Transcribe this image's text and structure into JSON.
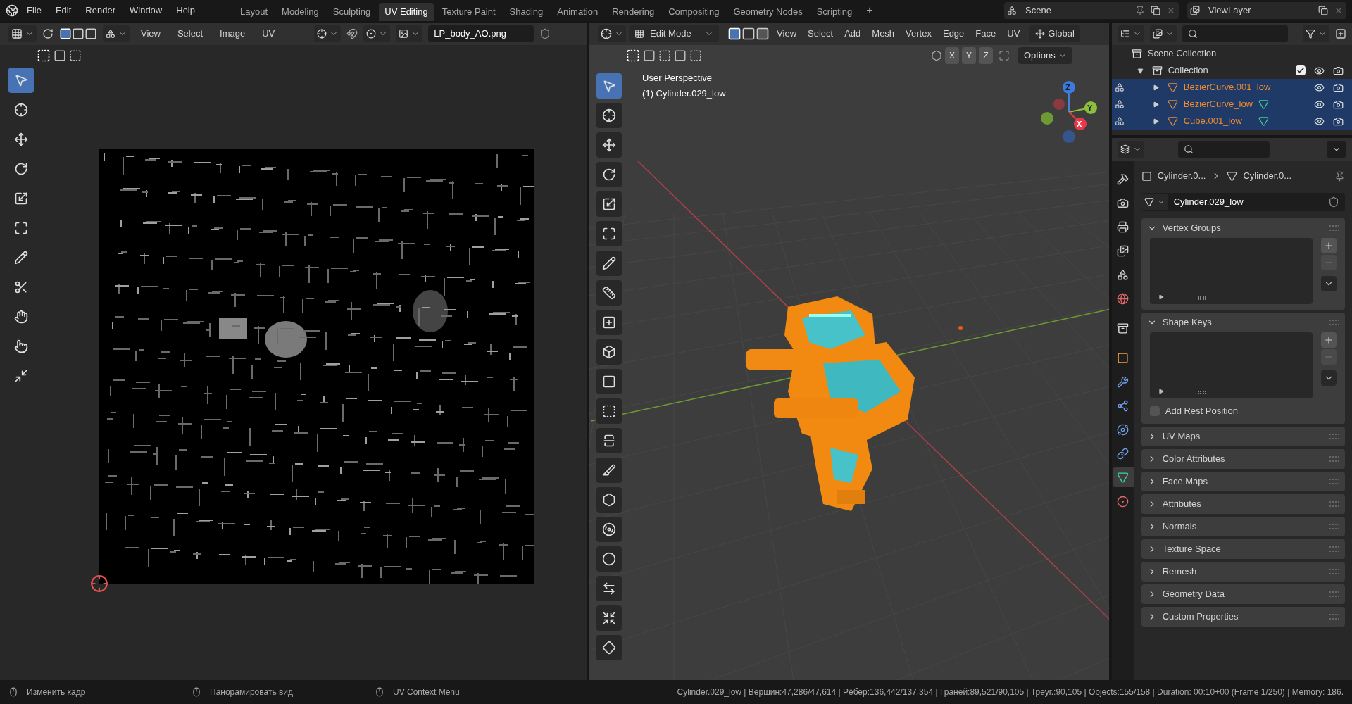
{
  "menu": [
    "File",
    "Edit",
    "Render",
    "Window",
    "Help"
  ],
  "workspaces": [
    {
      "label": "Layout",
      "selected": false
    },
    {
      "label": "Modeling",
      "selected": false
    },
    {
      "label": "Sculpting",
      "selected": false
    },
    {
      "label": "UV Editing",
      "selected": true
    },
    {
      "label": "Texture Paint",
      "selected": false
    },
    {
      "label": "Shading",
      "selected": false
    },
    {
      "label": "Animation",
      "selected": false
    },
    {
      "label": "Rendering",
      "selected": false
    },
    {
      "label": "Compositing",
      "selected": false
    },
    {
      "label": "Geometry Nodes",
      "selected": false
    },
    {
      "label": "Scripting",
      "selected": false
    }
  ],
  "add_workspace": "+",
  "scene": "Scene",
  "view_layer": "ViewLayer",
  "uv_editor": {
    "menus": [
      "View",
      "Select",
      "Image",
      "UV"
    ],
    "image": "LP_body_AO.png",
    "tools": [
      {
        "kind": "select",
        "selected": true
      },
      {
        "kind": "cursor",
        "selected": false
      },
      {
        "kind": "move",
        "selected": false
      },
      {
        "kind": "rotate",
        "selected": false
      },
      {
        "kind": "scale",
        "selected": false
      },
      {
        "kind": "transform",
        "selected": false
      },
      {
        "kind": "annotate",
        "selected": false
      },
      {
        "kind": "rip",
        "selected": false
      },
      {
        "kind": "grab",
        "selected": false
      },
      {
        "kind": "relax",
        "selected": false
      },
      {
        "kind": "pinch",
        "selected": false
      }
    ],
    "texture": {
      "kind": "picture"
    }
  },
  "viewport": {
    "mode": "Edit Mode",
    "menus": [
      "View",
      "Select",
      "Add",
      "Mesh",
      "Vertex",
      "Edge",
      "Face",
      "UV"
    ],
    "orientation": "Global",
    "mirror_axes": [
      "X",
      "Y",
      "Z"
    ],
    "options": "Options",
    "overlay": [
      "User Perspective",
      "(1) Cylinder.029_low"
    ],
    "gizmo": {
      "z": "Z",
      "y": "Y",
      "x": "X"
    },
    "tools": [
      {
        "kind": "select",
        "selected": true
      },
      {
        "kind": "cursor",
        "selected": false
      },
      {
        "kind": "move",
        "selected": false
      },
      {
        "kind": "rotate",
        "selected": false
      },
      {
        "kind": "scale",
        "selected": false
      },
      {
        "kind": "transform",
        "selected": false
      },
      {
        "kind": "annotate",
        "selected": false
      },
      {
        "kind": "measure",
        "selected": false
      },
      {
        "kind": "add-cube",
        "selected": false
      },
      {
        "kind": "extrude",
        "selected": false
      },
      {
        "kind": "inset",
        "selected": false
      },
      {
        "kind": "bevel",
        "selected": false
      },
      {
        "kind": "loopcut",
        "selected": false
      },
      {
        "kind": "knife",
        "selected": false
      },
      {
        "kind": "polybuild",
        "selected": false
      },
      {
        "kind": "spin",
        "selected": false
      },
      {
        "kind": "smooth",
        "selected": false
      },
      {
        "kind": "edge-slide",
        "selected": false
      },
      {
        "kind": "shrink",
        "selected": false
      },
      {
        "kind": "shear",
        "selected": false
      }
    ]
  },
  "outliner": {
    "root": "Scene Collection",
    "collection": {
      "name": "Collection",
      "checked": true,
      "expanded": true,
      "children": [
        {
          "name": "BezierCurve.001_low",
          "selected": true,
          "has_mesh_data": false
        },
        {
          "name": "BezierCurve_low",
          "selected": true,
          "has_mesh_data": true
        },
        {
          "name": "Cube.001_low",
          "selected": true,
          "has_mesh_data": true
        }
      ]
    }
  },
  "properties": {
    "tabs": [
      {
        "kind": "tool",
        "selected": false
      },
      {
        "kind": "render",
        "selected": false
      },
      {
        "kind": "output",
        "selected": false
      },
      {
        "kind": "view_layer",
        "selected": false
      },
      {
        "kind": "scene",
        "selected": false
      },
      {
        "kind": "world",
        "selected": false
      },
      {
        "kind": "collection",
        "selected": false
      },
      {
        "kind": "object",
        "selected": false
      },
      {
        "kind": "modifier",
        "selected": false
      },
      {
        "kind": "particles",
        "selected": false
      },
      {
        "kind": "physics",
        "selected": false
      },
      {
        "kind": "constraints",
        "selected": false
      },
      {
        "kind": "data",
        "selected": true
      },
      {
        "kind": "material",
        "selected": false
      }
    ],
    "breadcrumb": [
      "Cylinder.0...",
      "Cylinder.0..."
    ],
    "mesh_name": "Cylinder.029_low",
    "panels": [
      {
        "title": "Vertex Groups",
        "expanded": true,
        "kind": "list"
      },
      {
        "title": "Shape Keys",
        "expanded": true,
        "kind": "list",
        "checkbox": {
          "label": "Add Rest Position",
          "checked": false
        }
      },
      {
        "title": "UV Maps",
        "expanded": false
      },
      {
        "title": "Color Attributes",
        "expanded": false
      },
      {
        "title": "Face Maps",
        "expanded": false
      },
      {
        "title": "Attributes",
        "expanded": false
      },
      {
        "title": "Normals",
        "expanded": false
      },
      {
        "title": "Texture Space",
        "expanded": false
      },
      {
        "title": "Remesh",
        "expanded": false
      },
      {
        "title": "Geometry Data",
        "expanded": false
      },
      {
        "title": "Custom Properties",
        "expanded": false
      }
    ]
  },
  "status_bar": {
    "hints": [
      "Изменить кадр",
      "Панорамировать вид",
      "UV Context Menu"
    ],
    "stats": "Cylinder.029_low | Вершин:47,286/47,614 | Рёбер:136,442/137,354 | Граней:89,521/90,105 | Треуг.:90,105 | Objects:155/158 | Duration: 00:10+00 (Frame 1/250) | Memory: 186."
  }
}
